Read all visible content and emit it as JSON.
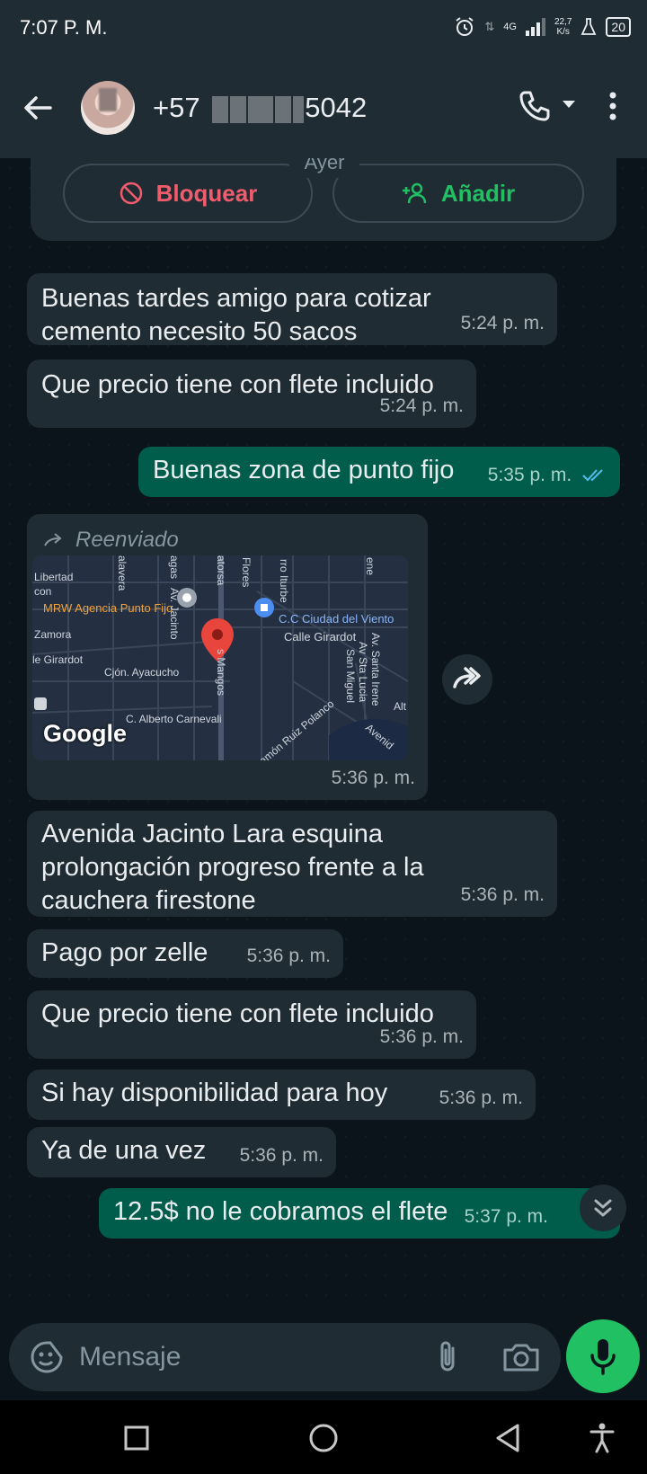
{
  "status": {
    "time": "7:07 P. M.",
    "network": "4G",
    "speed": "22,7",
    "speed_unit": "K/s",
    "battery": "20"
  },
  "header": {
    "contact_prefix": "+57",
    "contact_suffix": "5042"
  },
  "banner": {
    "day_label": "Ayer",
    "block_label": "Bloquear",
    "add_label": "Añadir"
  },
  "messages": [
    {
      "dir": "in",
      "text": "Buenas tardes amigo para cotizar cemento necesito 50 sacos",
      "time": "5:24 p. m."
    },
    {
      "dir": "in",
      "text": "Que precio tiene con flete incluido",
      "time": "5:24 p. m."
    },
    {
      "dir": "out",
      "text": "Buenas zona de punto fijo",
      "time": "5:35 p. m.",
      "status": "read"
    },
    {
      "dir": "in",
      "type": "location",
      "forwarded_label": "Reenviado",
      "time": "5:36 p. m."
    },
    {
      "dir": "in",
      "text": "Avenida Jacinto Lara esquina prolongación progreso frente a la cauchera firestone",
      "time": "5:36 p. m."
    },
    {
      "dir": "in",
      "text": "Pago por zelle",
      "time": "5:36 p. m."
    },
    {
      "dir": "in",
      "text": "Que precio tiene con flete incluido",
      "time": "5:36 p. m."
    },
    {
      "dir": "in",
      "text": "Si hay disponibilidad para hoy",
      "time": "5:36 p. m."
    },
    {
      "dir": "in",
      "text": "Ya de una vez",
      "time": "5:36 p. m."
    },
    {
      "dir": "out",
      "text": "12.5$ no le cobramos el flete",
      "time": "5:37 p. m."
    }
  ],
  "map": {
    "labels": [
      "Libertad",
      "MRW Agencia Punto Fijo",
      "C.C Ciudad del Viento",
      "Calle Girardot",
      "Zamora",
      "le Girardot",
      "Cjón. Ayacucho",
      "C. Alberto Carnevali",
      "Av. Jacinto",
      "s Mangos",
      "Av. Santa Irene",
      "Av Sta Lucia",
      "San Miguel",
      "Flores",
      "Ramón Ruiz Polanco",
      "Avenid",
      "alavera",
      "agas",
      "atorsa",
      "rro Iturbe",
      "ene",
      "con",
      "Alt"
    ],
    "attribution": "Google"
  },
  "composer": {
    "placeholder": "Mensaje"
  },
  "colors": {
    "header_bg": "#1f2c34",
    "incoming_bubble": "#202c33",
    "outgoing_bubble": "#005c4b",
    "accent_green": "#21c063",
    "block_red": "#f15c6d",
    "read_tick": "#53bdeb"
  }
}
